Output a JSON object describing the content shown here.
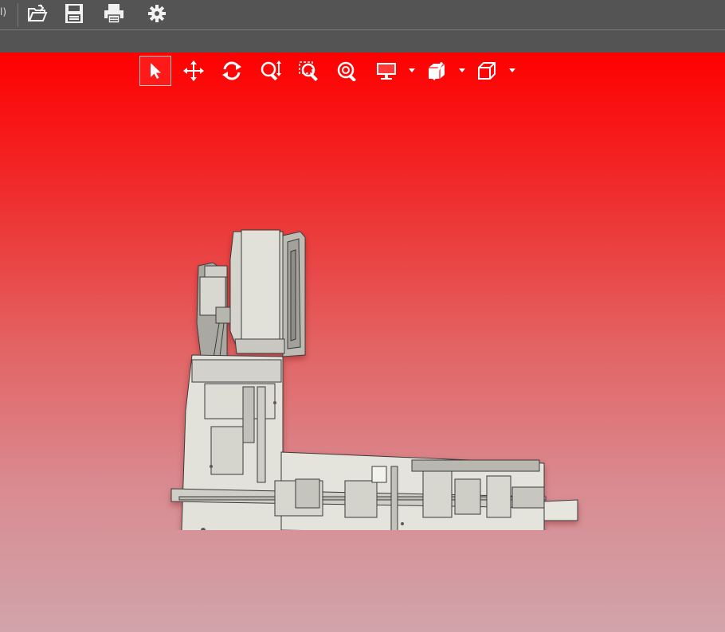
{
  "app_toolbar": {
    "partial_label": "l)",
    "buttons": [
      {
        "icon": "open-folder-icon"
      },
      {
        "icon": "save-icon"
      },
      {
        "icon": "print-icon"
      },
      {
        "icon": "settings-gear-icon"
      }
    ]
  },
  "view_toolbar": {
    "tools": [
      {
        "icon": "select-arrow-icon",
        "active": true
      },
      {
        "icon": "pan-move-icon"
      },
      {
        "icon": "rotate-icon"
      },
      {
        "icon": "zoom-in-out-icon"
      },
      {
        "icon": "zoom-to-area-icon"
      },
      {
        "icon": "zoom-to-fit-icon"
      },
      {
        "icon": "display-style-icon",
        "dropdown": true
      },
      {
        "icon": "section-view-icon",
        "dropdown": true
      },
      {
        "icon": "view-orientation-cube-icon",
        "dropdown": true
      }
    ]
  },
  "viewport": {
    "background_top": "#ff0000",
    "background_bottom": "#d0a4aa",
    "model_name": "machine-assembly-model"
  },
  "colors": {
    "toolbar_bg": "#545454",
    "icon_color": "#f2f2f2",
    "model_body": "#e4e3dc",
    "model_line": "#3a3a3a"
  }
}
